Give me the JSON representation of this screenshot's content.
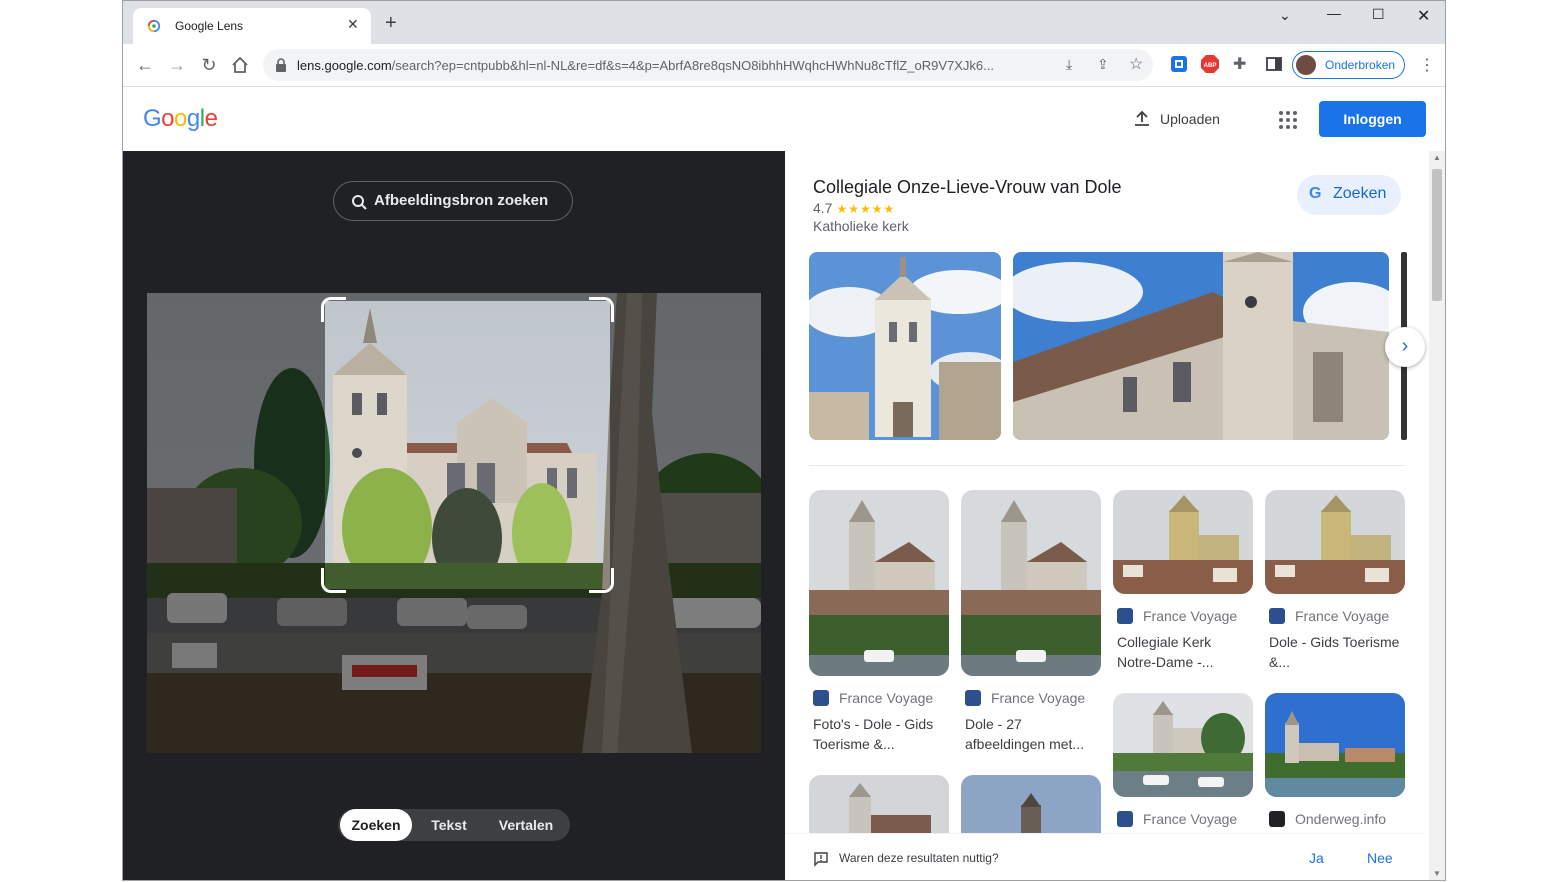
{
  "browser": {
    "tab_title": "Google Lens",
    "url_host": "lens.google.com",
    "url_path": "/search?ep=cntpubb&hl=nl-NL&re=df&s=4&p=AbrfA8re8qsNO8ibhhHWqhcHWhNu8cTflZ_oR9V7XJk6...",
    "profile_label": "Onderbroken"
  },
  "header": {
    "logo": "Google",
    "upload_label": "Uploaden",
    "signin_label": "Inloggen"
  },
  "left": {
    "find_source_label": "Afbeeldingsbron zoeken",
    "modes": [
      "Zoeken",
      "Tekst",
      "Vertalen"
    ],
    "active_mode": "Zoeken"
  },
  "entity": {
    "title": "Collegiale Onze-Lieve-Vrouw van Dole",
    "rating": "4.7",
    "stars": "★★★★★",
    "type": "Katholieke kerk",
    "search_button": "Zoeken"
  },
  "results": [
    {
      "source": "France Voyage",
      "title": "Foto's - Dole - Gids Toerisme &..."
    },
    {
      "source": "France Voyage",
      "title": "Dole - 27 afbeeldingen met..."
    },
    {
      "source": "France Voyage",
      "title": "Collegiale Kerk Notre-Dame -..."
    },
    {
      "source": "France Voyage",
      "title": "Dole - Gids Toerisme &..."
    },
    {
      "source": "France Voyage",
      "title": ""
    },
    {
      "source": "Onderweg.info",
      "title": ""
    }
  ],
  "feedback": {
    "question": "Waren deze resultaten nuttig?",
    "yes": "Ja",
    "no": "Nee"
  },
  "colors": {
    "accent": "#1a73e8",
    "dark_panel": "#202124"
  }
}
